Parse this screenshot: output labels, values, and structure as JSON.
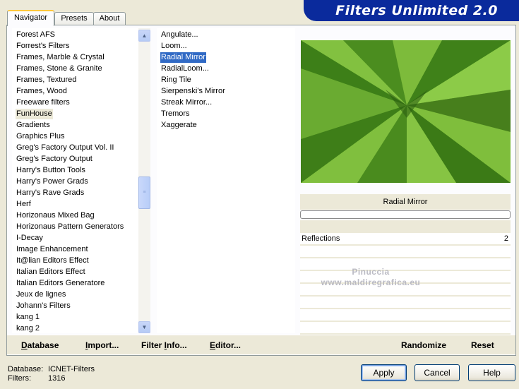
{
  "tabs": [
    "Navigator",
    "Presets",
    "About"
  ],
  "banner": {
    "title": "Filters Unlimited 2.0"
  },
  "categories": [
    "Forest AFS",
    "Forrest's Filters",
    "Frames, Marble & Crystal",
    "Frames, Stone & Granite",
    "Frames, Textured",
    "Frames, Wood",
    "Freeware filters",
    "FunHouse",
    "Gradients",
    "Graphics Plus",
    "Greg's Factory Output Vol. II",
    "Greg's Factory Output",
    "Harry's Button Tools",
    "Harry's Power Grads",
    "Harry's Rave Grads",
    "Herf",
    "Horizonaus Mixed Bag",
    "Horizonaus Pattern Generators",
    "I-Decay",
    "Image Enhancement",
    "It@lian Editors Effect",
    "Italian Editors Effect",
    "Italian Editors Generatore",
    "Jeux de lignes",
    "Johann's Filters",
    "kang 1",
    "kang 2"
  ],
  "selected_category": "FunHouse",
  "filters": [
    "Angulate...",
    "Loom...",
    "Radial Mirror",
    "RadialLoom...",
    "Ring Tile",
    "Sierpenski's Mirror",
    "Streak Mirror...",
    "Tremors",
    "Xaggerate"
  ],
  "selected_filter": "Radial Mirror",
  "preview": {
    "filter_name": "Radial Mirror",
    "progress_fraction": 0.0
  },
  "parameters": [
    {
      "label": "Reflections",
      "value": "2"
    }
  ],
  "watermark": {
    "line1": "Pinuccia",
    "line2": "www.maldiregrafica.eu"
  },
  "bottom_actions": {
    "database_prefix": "D",
    "database_rest": "atabase",
    "import_prefix": "I",
    "import_rest": "mport...",
    "filterinfo_a": "Filter ",
    "filterinfo_u": "I",
    "filterinfo_b": "nfo...",
    "editor_prefix": "E",
    "editor_rest": "ditor...",
    "randomize": "Randomize",
    "reset": "Reset"
  },
  "status": {
    "database_label": "Database:",
    "database_value": "ICNET-Filters",
    "filters_label": "Filters:",
    "filters_value": "1316"
  },
  "buttons": {
    "apply": "Apply",
    "cancel": "Cancel",
    "help": "Help"
  },
  "colors": {
    "banner": "#0a2a9c",
    "selection": "#316ac5",
    "preview_green": "#5ea12a"
  }
}
